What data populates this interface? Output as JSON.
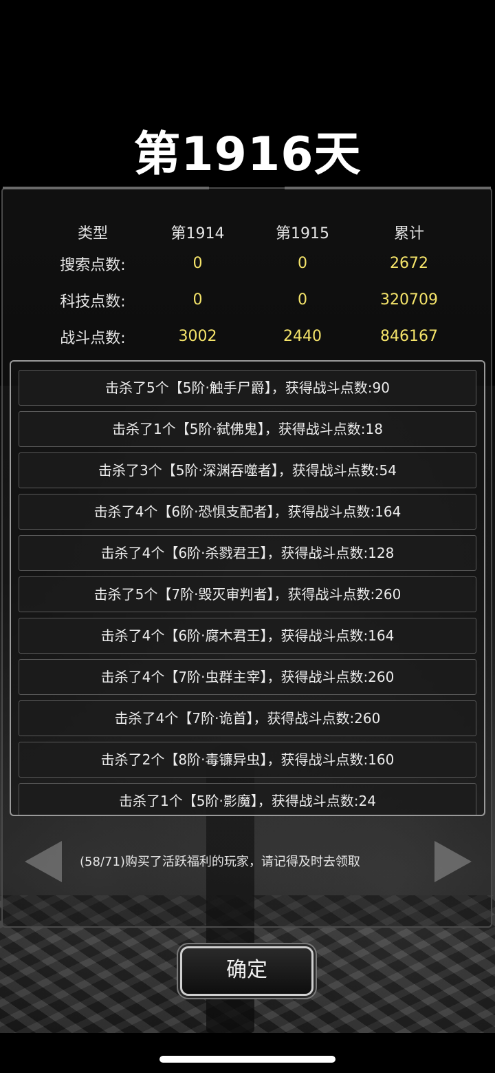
{
  "title": "第1916天",
  "stats": {
    "headers": [
      "类型",
      "第1914",
      "第1915",
      "累计"
    ],
    "rows": [
      {
        "label": "搜索点数:",
        "d1914": "0",
        "d1915": "0",
        "total": "2672"
      },
      {
        "label": "科技点数:",
        "d1914": "0",
        "d1915": "0",
        "total": "320709"
      },
      {
        "label": "战斗点数:",
        "d1914": "3002",
        "d1915": "2440",
        "total": "846167"
      }
    ]
  },
  "kill_log": [
    "击杀了5个【5阶·触手尸爵】，获得战斗点数:90",
    "击杀了1个【5阶·弑佛鬼】，获得战斗点数:18",
    "击杀了3个【5阶·深渊吞噬者】，获得战斗点数:54",
    "击杀了4个【6阶·恐惧支配者】，获得战斗点数:164",
    "击杀了4个【6阶·杀戮君王】，获得战斗点数:128",
    "击杀了5个【7阶·毁灭审判者】，获得战斗点数:260",
    "击杀了4个【6阶·腐木君王】，获得战斗点数:164",
    "击杀了4个【7阶·虫群主宰】，获得战斗点数:260",
    "击杀了4个【7阶·诡首】，获得战斗点数:260",
    "击杀了2个【8阶·毒镰异虫】，获得战斗点数:160",
    "击杀了1个【5阶·影魔】，获得战斗点数:24"
  ],
  "notice": "(58/71)购买了活跃福利的玩家，请记得及时去领取",
  "confirm_label": "确定",
  "colors": {
    "value": "#f5e46a",
    "text": "#e8e8e8",
    "background": "#000000"
  }
}
